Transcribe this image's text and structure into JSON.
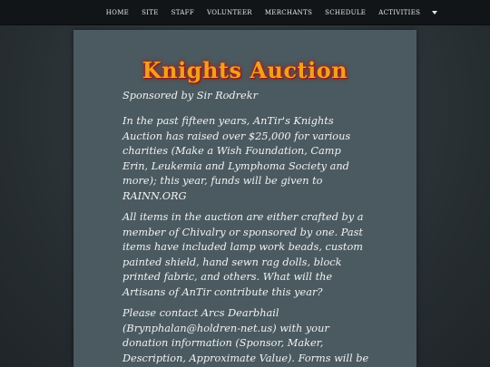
{
  "nav": {
    "items": [
      "Home",
      "Site",
      "Staff",
      "Volunteer",
      "Merchants",
      "Schedule",
      "Activities"
    ],
    "more_icon": "chevron-down-icon"
  },
  "page": {
    "title": "Knights Auction",
    "sponsor": "Sponsored by Sir Rodrekr",
    "paragraphs": [
      "In the past fifteen years, AnTir's Knights Auction has raised over $25,000 for various charities (Make a Wish Foundation, Camp Erin, Leukemia and Lymphoma Society and more); this year, funds will be given to RAINN.ORG",
      "All items in the auction are either crafted by a member of Chivalry or sponsored by one. Past items have included lamp work beads, custom painted shield, hand sewn rag dolls, block printed fabric, and others. What will the Artisans of AnTir contribute this year?",
      "Please contact Arcs Dearbhail (Brynphalan@holdren-net.us) with your donation information (Sponsor, Maker, Description, Approximate Value). Forms will be available at Gate."
    ]
  },
  "colors": {
    "navbar": "#121517",
    "panel": "#4a5a60",
    "title": "#f0a020",
    "title_glow": "#c62010",
    "text": "#f2f2f2"
  }
}
